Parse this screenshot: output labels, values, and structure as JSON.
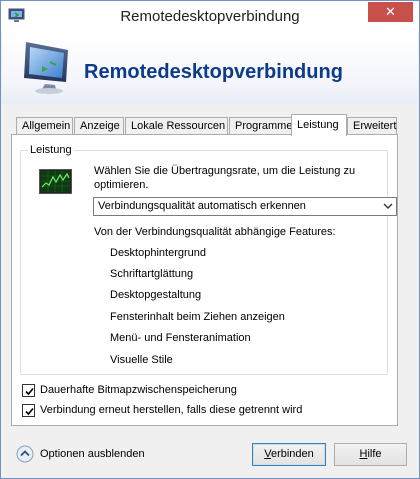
{
  "window": {
    "title": "Remotedesktopverbindung",
    "close_glyph": "✕"
  },
  "banner": {
    "title": "Remotedesktopverbindung",
    "icon": "remote-desktop-monitor-icon"
  },
  "tabs": [
    {
      "label": "Allgemein",
      "active": false
    },
    {
      "label": "Anzeige",
      "active": false
    },
    {
      "label": "Lokale Ressourcen",
      "active": false
    },
    {
      "label": "Programme",
      "active": false
    },
    {
      "label": "Leistung",
      "active": true
    },
    {
      "label": "Erweitert",
      "active": false
    }
  ],
  "performance": {
    "group_label": "Leistung",
    "intro": "Wählen Sie die Übertragungsrate, um die Leistung zu optimieren.",
    "connection_select": {
      "value": "Verbindungsqualität automatisch erkennen"
    },
    "features_label": "Von der Verbindungsqualität abhängige Features:",
    "features": [
      "Desktophintergrund",
      "Schriftartglättung",
      "Desktopgestaltung",
      "Fensterinhalt beim Ziehen anzeigen",
      "Menü- und Fensteranimation",
      "Visuelle Stile"
    ]
  },
  "checkboxes": [
    {
      "label": "Dauerhafte Bitmapzwischenspeicherung",
      "checked": true
    },
    {
      "label": "Verbindung erneut herstellen, falls diese getrennt wird",
      "checked": true
    }
  ],
  "footer": {
    "options_label": "Optionen ausblenden",
    "connect_button": {
      "prefix": "",
      "accel": "V",
      "rest": "erbinden"
    },
    "help_button": {
      "prefix": "",
      "accel": "H",
      "rest": "ilfe"
    }
  },
  "colors": {
    "banner_title": "#0c3b8b",
    "close_button": "#c7504b",
    "window_border": "#6f91c4"
  }
}
